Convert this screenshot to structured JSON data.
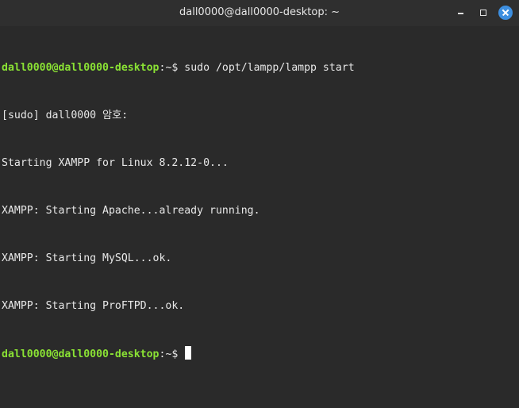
{
  "window": {
    "title": "dall0000@dall0000-desktop: ~"
  },
  "terminal": {
    "lines": [
      {
        "type": "prompt",
        "user": "dall0000@dall0000-desktop",
        "path": ":~$ ",
        "command": "sudo /opt/lampp/lampp start"
      },
      {
        "type": "output",
        "text": "[sudo] dall0000 암호:"
      },
      {
        "type": "output",
        "text": "Starting XAMPP for Linux 8.2.12-0..."
      },
      {
        "type": "output",
        "text": "XAMPP: Starting Apache...already running."
      },
      {
        "type": "output",
        "text": "XAMPP: Starting MySQL...ok."
      },
      {
        "type": "output",
        "text": "XAMPP: Starting ProFTPD...ok."
      },
      {
        "type": "prompt",
        "user": "dall0000@dall0000-desktop",
        "path": ":~$ ",
        "command": ""
      }
    ]
  },
  "colors": {
    "background": "#2a2a2a",
    "titlebar": "#2f2f2f",
    "prompt_user": "#8ae234",
    "text": "#e8e8e8",
    "close_button": "#3d8fe0"
  },
  "icons": [
    "minimize-icon",
    "maximize-icon",
    "close-icon"
  ]
}
